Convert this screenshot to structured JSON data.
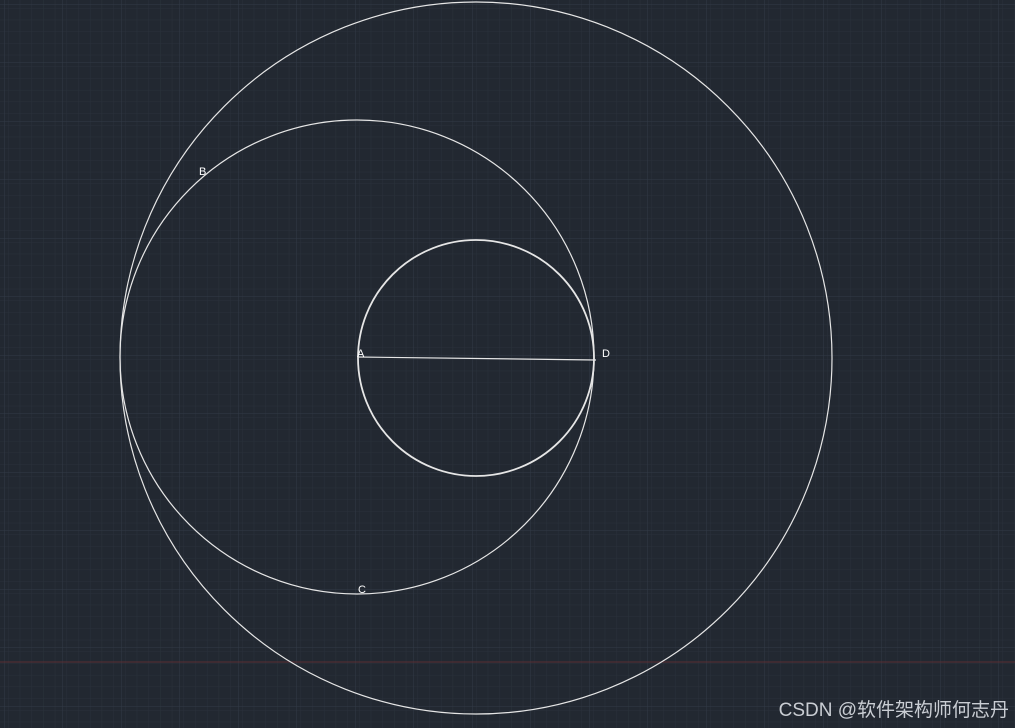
{
  "drawing": {
    "background_color": "#222831",
    "minor_grid_color": "#2a313b",
    "major_grid_color": "#323a46",
    "axis_line_color": "#5a2e34",
    "stroke_color": "#e6e6e6",
    "points": [
      {
        "id": "A",
        "label": "A"
      },
      {
        "id": "B",
        "label": "B"
      },
      {
        "id": "C",
        "label": "C"
      },
      {
        "id": "D",
        "label": "D"
      }
    ],
    "shapes": [
      {
        "kind": "circle",
        "name": "outer-circle"
      },
      {
        "kind": "circle",
        "name": "middle-circle"
      },
      {
        "kind": "circle",
        "name": "inner-circle"
      },
      {
        "kind": "line",
        "name": "segment-ad",
        "from": "A",
        "to": "D"
      }
    ]
  },
  "watermark": {
    "text": "CSDN @软件架构师何志丹"
  }
}
